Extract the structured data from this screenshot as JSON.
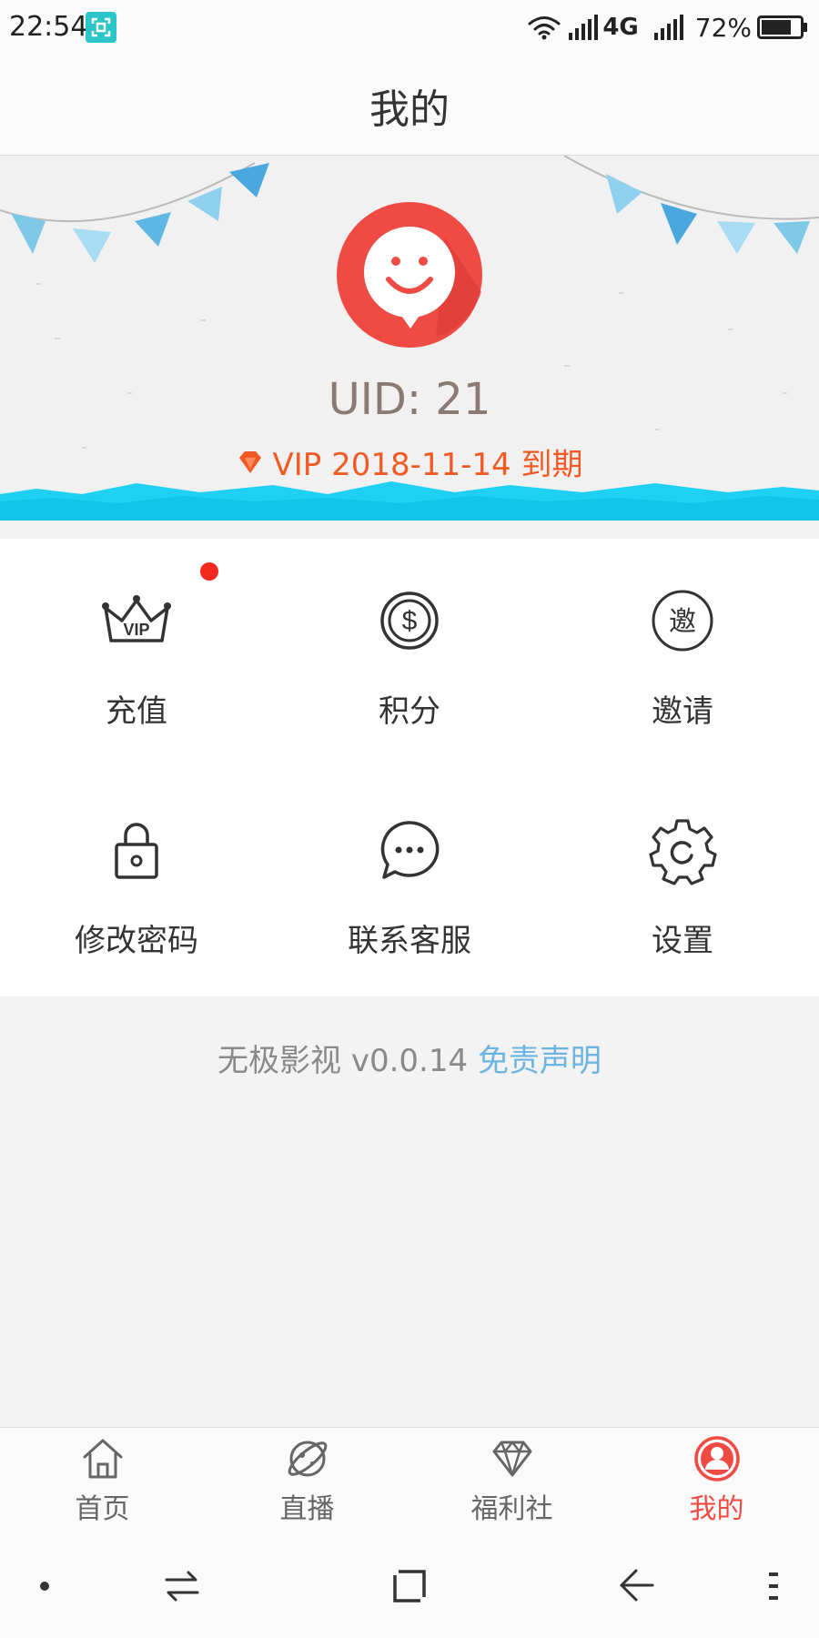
{
  "status_bar": {
    "time": "22:54",
    "network": "4G",
    "battery": "72%",
    "icons": [
      "screenshot-icon",
      "wifi-icon",
      "signal-icon",
      "signal-icon",
      "battery-icon"
    ]
  },
  "header": {
    "title": "我的"
  },
  "profile": {
    "uid": "UID: 21",
    "vip_status": "VIP 2018-11-14 到期",
    "avatar_icon": "smiley-speech-bubble-icon",
    "accent_color": "#f04b43",
    "vip_color": "#f15a24"
  },
  "menu": {
    "items": [
      {
        "label": "充值",
        "icon": "vip-crown-icon",
        "has_badge": true
      },
      {
        "label": "积分",
        "icon": "dollar-coin-icon"
      },
      {
        "label": "邀请",
        "icon": "invite-circle-icon"
      },
      {
        "label": "修改密码",
        "icon": "lock-icon"
      },
      {
        "label": "联系客服",
        "icon": "chat-bubble-icon"
      },
      {
        "label": "设置",
        "icon": "gear-icon"
      }
    ]
  },
  "footer": {
    "version_text": "无极影视 v0.0.14",
    "disclaimer_link": "免责声明"
  },
  "tabbar": {
    "tabs": [
      {
        "label": "首页",
        "icon": "home-icon"
      },
      {
        "label": "直播",
        "icon": "planet-icon"
      },
      {
        "label": "福利社",
        "icon": "diamond-icon"
      },
      {
        "label": "我的",
        "icon": "user-icon",
        "active": true
      }
    ]
  },
  "system_nav": {
    "icons": [
      "dot-icon",
      "switch-arrows-icon",
      "home-square-icon",
      "back-arrow-icon",
      "menu-dots-icon"
    ]
  }
}
